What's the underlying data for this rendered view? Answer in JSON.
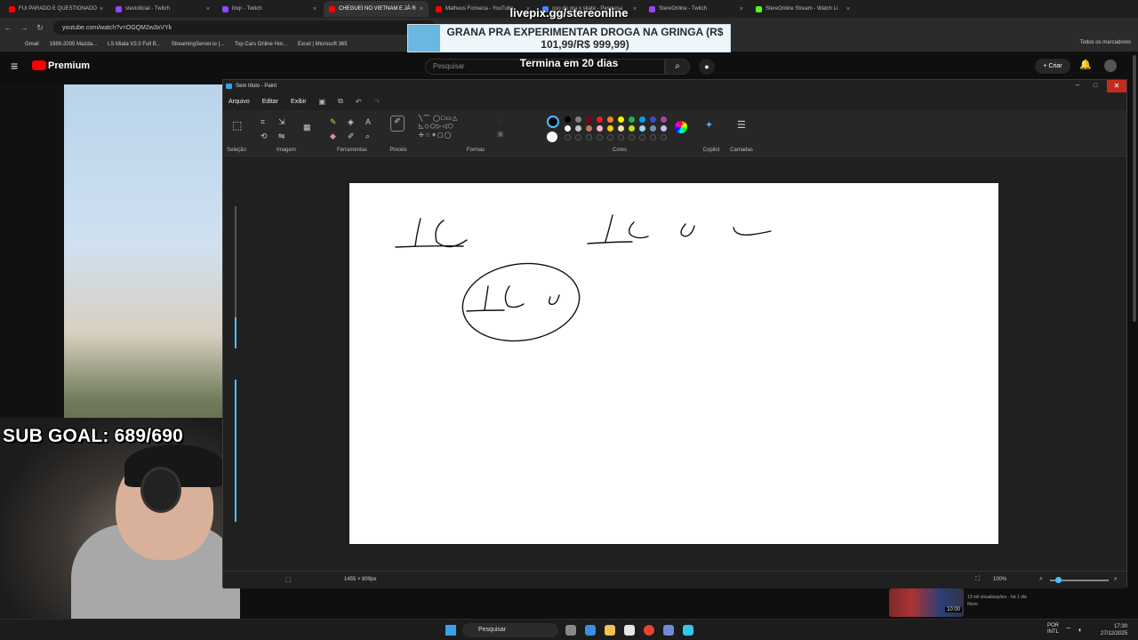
{
  "browser": {
    "tabs": [
      {
        "label": "FUI PARADO E QUESTIONADO",
        "color": "#ff0000",
        "active": false
      },
      {
        "label": "stevioficial - Twitch",
        "color": "#9146ff",
        "active": false
      },
      {
        "label": "linqr - Twitch",
        "color": "#9146ff",
        "active": false
      },
      {
        "label": "CHEGUEI NO VIETNAM E JÁ R",
        "color": "#ff0000",
        "active": true
      },
      {
        "label": "Matheus Fonseca - YouTube",
        "color": "#ff0000",
        "active": false
      },
      {
        "label": "coo do ora x skate - Pesquisa",
        "color": "#4285f4",
        "active": false
      },
      {
        "label": "StereOnline - Twitch",
        "color": "#9146ff",
        "active": false
      },
      {
        "label": "StereOnline Stream - Watch Li",
        "color": "#53fc18",
        "active": false
      }
    ],
    "url": "youtube.com/watch?v=OGQM2w3xVYk",
    "bookmarks": [
      "Gmail",
      "1989-2005 Mazda...",
      "LS Miata V2.0 Full B...",
      "StreamingServer.io |...",
      "Top Cars Online Hor...",
      "Excel | Microsoft 365"
    ],
    "bookmarks_right": "Todos os marcadores"
  },
  "youtube": {
    "brand": "Premium",
    "search_placeholder": "Pesquisar",
    "create_label": "Criar"
  },
  "overlay": {
    "livepix_url": "livepix.gg/stereonline",
    "message": "GRANA PRA EXPERIMENTAR DROGA NA GRINGA (R$ 101,99/R$ 999,99)",
    "timer": "Termina em 20 dias",
    "sub_goal": "SUB GOAL: 689/690"
  },
  "paint": {
    "title": "Sem título - Paint",
    "menu": [
      "Arquivo",
      "Editar",
      "Exibir"
    ],
    "groups": [
      "Seleção",
      "Imagem",
      "Ferramentas",
      "Pincéis",
      "Formas",
      "Cores",
      "Copilot",
      "Camadas"
    ],
    "palette_row1": [
      "#000000",
      "#7f7f7f",
      "#880015",
      "#ed1c24",
      "#ff7f27",
      "#fff200",
      "#22b14c",
      "#00a2e8",
      "#3f48cc",
      "#a349a4"
    ],
    "palette_row2": [
      "#ffffff",
      "#c3c3c3",
      "#b97a57",
      "#ffaec9",
      "#ffc90e",
      "#efe4b0",
      "#b5e61d",
      "#99d9ea",
      "#7092be",
      "#c8bfe7"
    ],
    "status_dims": "1455 × 809px",
    "zoom": "100%"
  },
  "taskbar": {
    "search": "Pesquisar",
    "lang1": "POR",
    "lang2": "INTL",
    "time": "17:30",
    "date": "27/12/2025"
  },
  "recommendation": {
    "duration": "10:00",
    "meta1": "13 mil visualizações · há 1 dia",
    "meta2": "Novo"
  }
}
